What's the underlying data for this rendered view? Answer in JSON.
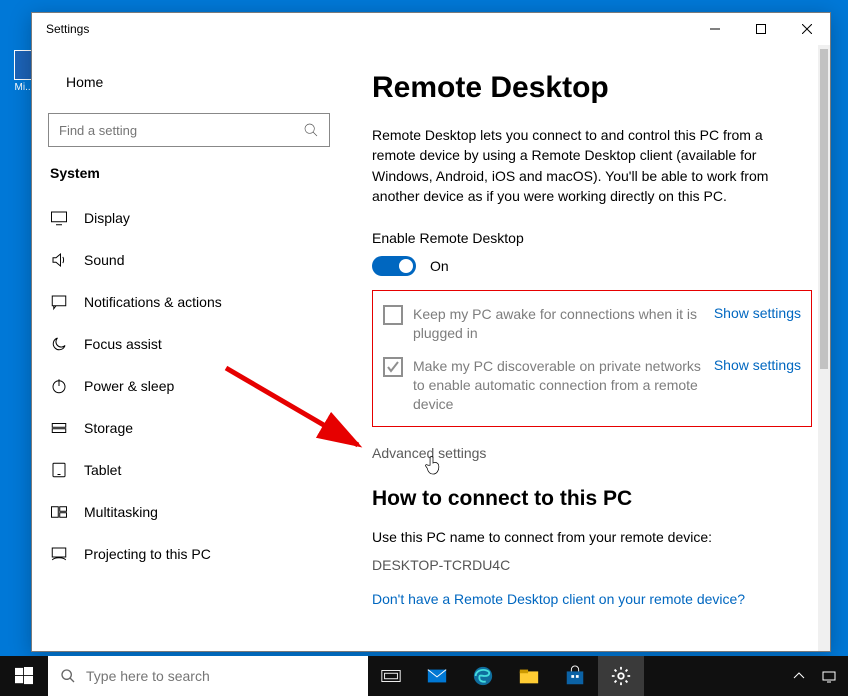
{
  "desktop": {
    "icon_label": "Mi..."
  },
  "window": {
    "title": "Settings"
  },
  "sidebar": {
    "home": "Home",
    "search_placeholder": "Find a setting",
    "section": "System",
    "items": [
      {
        "label": "Display"
      },
      {
        "label": "Sound"
      },
      {
        "label": "Notifications & actions"
      },
      {
        "label": "Focus assist"
      },
      {
        "label": "Power & sleep"
      },
      {
        "label": "Storage"
      },
      {
        "label": "Tablet"
      },
      {
        "label": "Multitasking"
      },
      {
        "label": "Projecting to this PC"
      }
    ]
  },
  "content": {
    "title": "Remote Desktop",
    "description": "Remote Desktop lets you connect to and control this PC from a remote device by using a Remote Desktop client (available for Windows, Android, iOS and macOS). You'll be able to work from another device as if you were working directly on this PC.",
    "enable_label": "Enable Remote Desktop",
    "toggle_state": "On",
    "option1": "Keep my PC awake for connections when it is plugged in",
    "option1_link": "Show settings",
    "option2": "Make my PC discoverable on private networks to enable automatic connection from a remote device",
    "option2_link": "Show settings",
    "advanced": "Advanced settings",
    "connect_header": "How to connect to this PC",
    "connect_text": "Use this PC name to connect from your remote device:",
    "pc_name": "DESKTOP-TCRDU4C",
    "client_link": "Don't have a Remote Desktop client on your remote device?"
  },
  "taskbar": {
    "search_placeholder": "Type here to search"
  }
}
